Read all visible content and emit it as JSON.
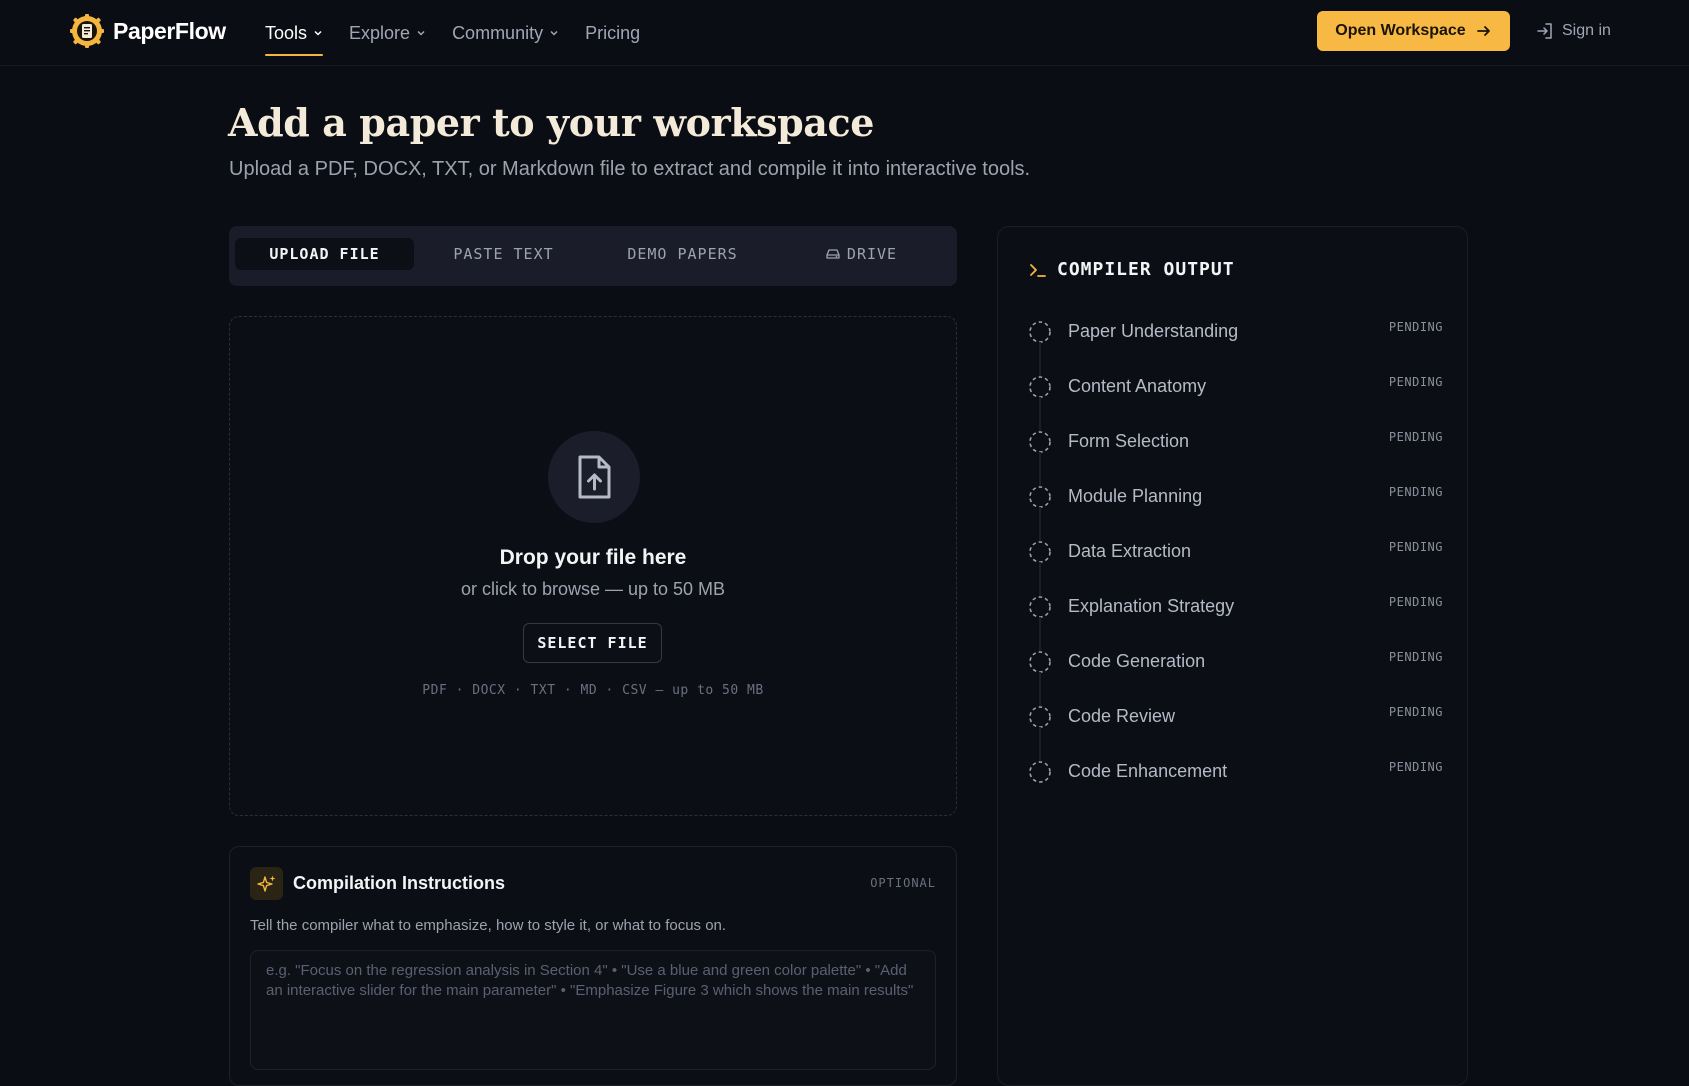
{
  "brand": {
    "name": "PaperFlow"
  },
  "nav": {
    "links": [
      {
        "label": "Tools",
        "active": true,
        "dropdown": true
      },
      {
        "label": "Explore",
        "active": false,
        "dropdown": true
      },
      {
        "label": "Community",
        "active": false,
        "dropdown": true
      },
      {
        "label": "Pricing",
        "active": false,
        "dropdown": false
      }
    ],
    "open_workspace": "Open Workspace",
    "sign_in": "Sign in"
  },
  "page": {
    "title": "Add a paper to your workspace",
    "subtitle": "Upload a PDF, DOCX, TXT, or Markdown file to extract and compile it into interactive tools."
  },
  "tabs": [
    {
      "label": "UPLOAD FILE",
      "active": true
    },
    {
      "label": "PASTE TEXT",
      "active": false
    },
    {
      "label": "DEMO PAPERS",
      "active": false
    },
    {
      "label": "DRIVE",
      "active": false,
      "icon": "drive-icon"
    }
  ],
  "dropzone": {
    "title": "Drop your file here",
    "subtitle": "or click to browse — up to 50 MB",
    "button": "SELECT FILE",
    "formats": "PDF · DOCX · TXT · MD · CSV — up to 50 MB",
    "icon": "file-upload-icon"
  },
  "instructions": {
    "title": "Compilation Instructions",
    "badge": "OPTIONAL",
    "description": "Tell the compiler what to emphasize, how to style it, or what to focus on.",
    "placeholder": "e.g. \"Focus on the regression analysis in Section 4\" • \"Use a blue and green color palette\" • \"Add an interactive slider for the main parameter\" • \"Emphasize Figure 3 which shows the main results\"",
    "value": "",
    "icon": "sparkle-icon"
  },
  "compiler": {
    "title": "COMPILER OUTPUT",
    "icon": "terminal-prompt-icon",
    "steps": [
      {
        "label": "Paper Understanding",
        "status": "PENDING"
      },
      {
        "label": "Content Anatomy",
        "status": "PENDING"
      },
      {
        "label": "Form Selection",
        "status": "PENDING"
      },
      {
        "label": "Module Planning",
        "status": "PENDING"
      },
      {
        "label": "Data Extraction",
        "status": "PENDING"
      },
      {
        "label": "Explanation Strategy",
        "status": "PENDING"
      },
      {
        "label": "Code Generation",
        "status": "PENDING"
      },
      {
        "label": "Code Review",
        "status": "PENDING"
      },
      {
        "label": "Code Enhancement",
        "status": "PENDING"
      }
    ]
  },
  "colors": {
    "background": "#0b0d14",
    "accent": "#f7b844",
    "panel": "#1a1d29",
    "title_text": "#f3ead9"
  }
}
